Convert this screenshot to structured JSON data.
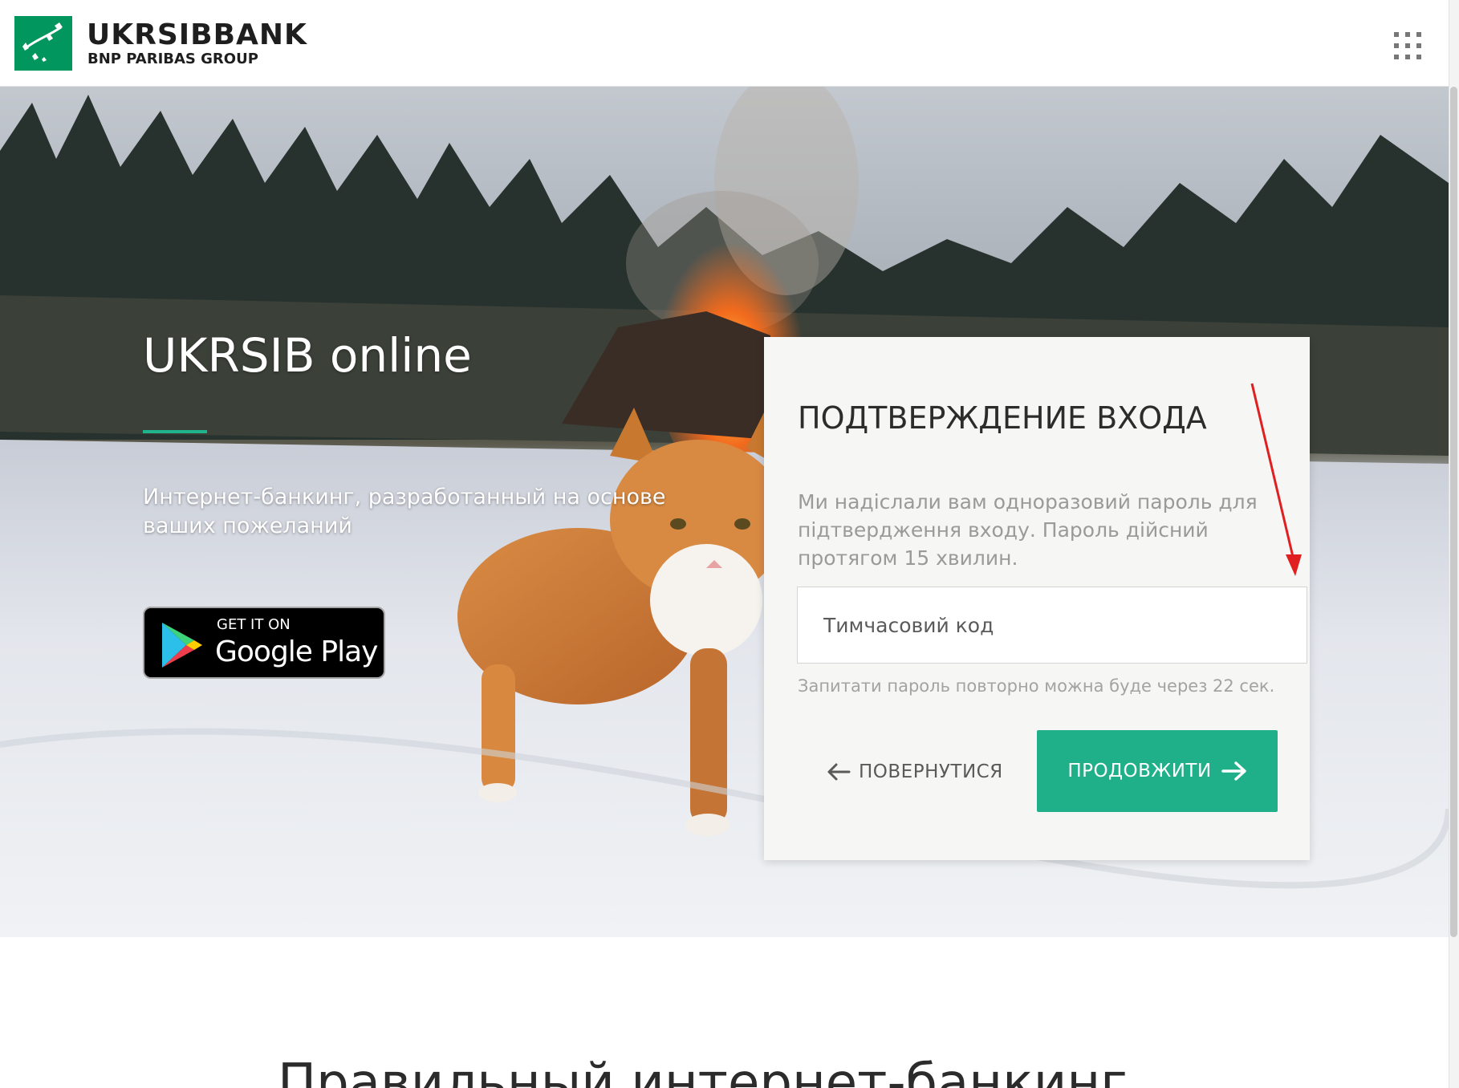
{
  "header": {
    "brand_name": "UKRSIBBANK",
    "brand_sub": "BNP PARIBAS GROUP",
    "apps_icon": "grid-apps-icon"
  },
  "hero": {
    "title": "UKRSIB online",
    "subtitle": "Интернет-банкинг, разработанный на основе ваших пожеланий",
    "store_badge": {
      "small_text": "GET IT ON",
      "big_text": "Google Play"
    }
  },
  "login_card": {
    "title": "ПОДТВЕРЖДЕНИЕ ВХОДА",
    "description": "Ми надіслали вам одноразовий пароль для підтвердження входу. Пароль дійсний протягом 15 хвилин.",
    "code_input": {
      "placeholder": "Тимчасовий код",
      "value": ""
    },
    "resend_notice": "Запитати пароль повторно можна буде через 22 сек.",
    "back_button": "ПОВЕРНУТИСЯ",
    "continue_button": "ПРОДОВЖИТИ"
  },
  "below": {
    "section_title": "Правильный интернет-банкинг"
  },
  "colors": {
    "brand_green": "#00965e",
    "accent_teal": "#1fb08a",
    "annotation_red": "#e02020"
  }
}
